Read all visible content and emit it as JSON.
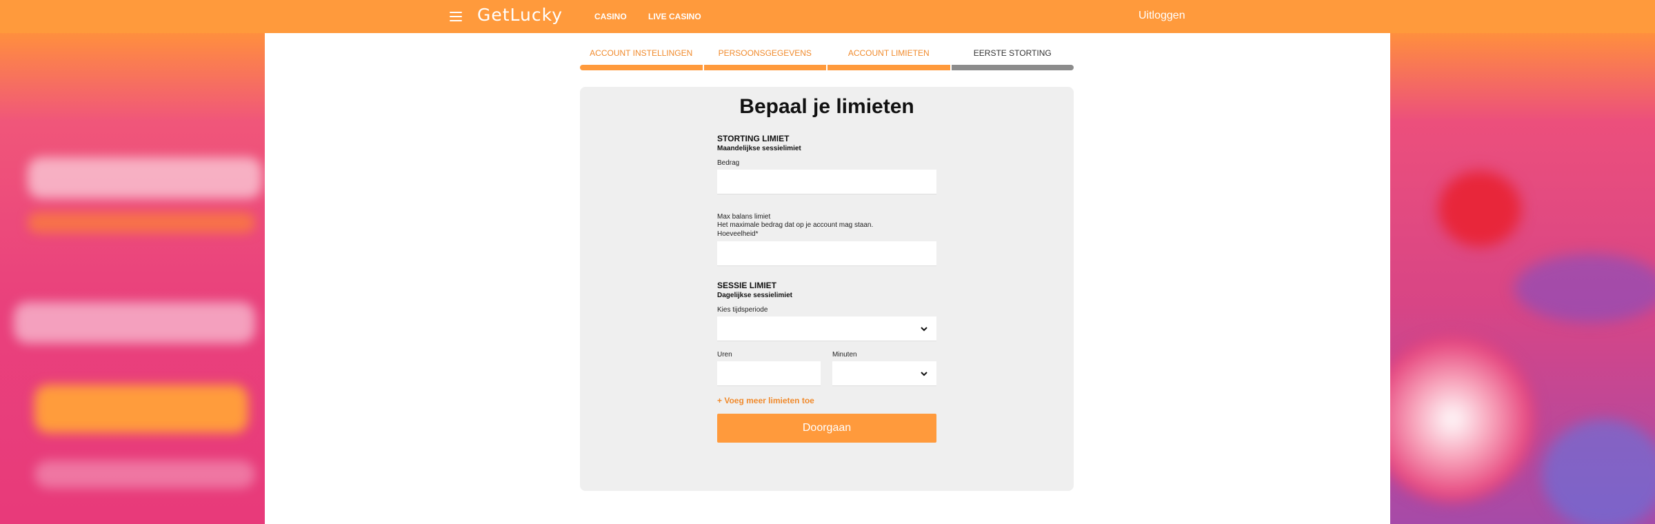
{
  "nav": {
    "logo": "GetLucky",
    "links": [
      "CASINO",
      "LIVE CASINO"
    ],
    "logout": "Uitloggen"
  },
  "steps": [
    {
      "label": "ACCOUNT INSTELLINGEN",
      "state": "done"
    },
    {
      "label": "PERSOONSGEGEVENS",
      "state": "done"
    },
    {
      "label": "ACCOUNT LIMIETEN",
      "state": "active"
    },
    {
      "label": "EERSTE STORTING",
      "state": "todo"
    }
  ],
  "form": {
    "title": "Bepaal je limieten",
    "deposit": {
      "title": "STORTING LIMIET",
      "subtitle": "Maandelijkse sessielimiet",
      "amount_label": "Bedrag",
      "amount_value": ""
    },
    "balance": {
      "title": "Max balans limiet",
      "description": "Het maximale bedrag dat op je account mag staan.",
      "quantity_label": "Hoeveelheid*",
      "quantity_value": ""
    },
    "session": {
      "title": "SESSIE LIMIET",
      "subtitle": "Dagelijkse sessielimiet",
      "period_label": "Kies tijdsperiode",
      "period_value": "",
      "hours_label": "Uren",
      "hours_value": "",
      "minutes_label": "Minuten",
      "minutes_value": ""
    },
    "add_more": "+ Voeg meer limieten toe",
    "submit": "Doorgaan"
  },
  "colors": {
    "accent": "#ff9a3c",
    "inactive_step": "#8c8c8c",
    "card_bg": "#efefef"
  }
}
